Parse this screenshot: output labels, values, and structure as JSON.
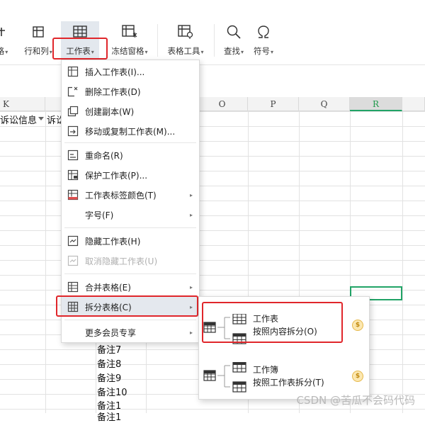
{
  "ribbon": {
    "partial_left_label": "格",
    "rows_cols_label": "行和列",
    "worksheet_label": "工作表",
    "freeze_label": "冻结窗格",
    "table_tools_label": "表格工具",
    "find_label": "查找",
    "symbol_label": "符号"
  },
  "sheet": {
    "columns": [
      "K",
      "O",
      "P",
      "Q",
      "R"
    ],
    "selected_column": "R",
    "cell_k1": "诉讼信息",
    "cell_l1": "诉讼",
    "notes": [
      "备注7",
      "备注8",
      "备注9",
      "备注10",
      "备注1",
      "备注1"
    ]
  },
  "menu": {
    "items": [
      {
        "label": "插入工作表(I)..."
      },
      {
        "label": "删除工作表(D)"
      },
      {
        "label": "创建副本(W)"
      },
      {
        "label": "移动或复制工作表(M)..."
      },
      {
        "label": "重命名(R)"
      },
      {
        "label": "保护工作表(P)..."
      },
      {
        "label": "工作表标签颜色(T)"
      },
      {
        "label": "字号(F)"
      },
      {
        "label": "隐藏工作表(H)"
      },
      {
        "label": "取消隐藏工作表(U)"
      },
      {
        "label": "合并表格(E)"
      },
      {
        "label": "拆分表格(C)"
      },
      {
        "label": "更多会员专享"
      }
    ]
  },
  "submenu": {
    "options": [
      {
        "title": "工作表",
        "desc": "按照内容拆分(O)"
      },
      {
        "title": "工作簿",
        "desc": "按照工作表拆分(T)"
      }
    ],
    "vip_badge": "$"
  },
  "watermark": "CSDN @苦瓜不会码代码",
  "colors": {
    "accent_red": "#e0262b",
    "selection_green": "#21a366"
  }
}
